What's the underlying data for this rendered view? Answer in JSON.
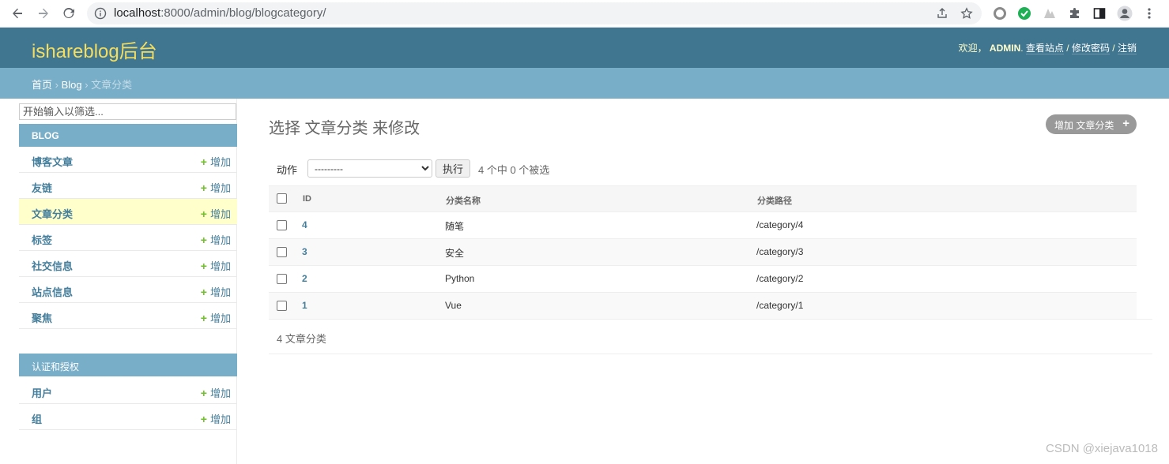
{
  "browser": {
    "url_host": "localhost",
    "url_path": ":8000/admin/blog/blogcategory/"
  },
  "header": {
    "branding": "ishareblog后台",
    "welcome": "欢迎，",
    "username": "ADMIN",
    "view_site": "查看站点",
    "change_password": "修改密码",
    "logout": "注销",
    "sep": " / "
  },
  "breadcrumbs": {
    "home": "首页",
    "app": "Blog",
    "current": "文章分类",
    "sep": " › "
  },
  "sidebar": {
    "filter_placeholder": "开始输入以筛选...",
    "modules": [
      {
        "caption": "BLOG",
        "models": [
          {
            "name": "博客文章",
            "add": "增加",
            "current": false
          },
          {
            "name": "友链",
            "add": "增加",
            "current": false
          },
          {
            "name": "文章分类",
            "add": "增加",
            "current": true
          },
          {
            "name": "标签",
            "add": "增加",
            "current": false
          },
          {
            "name": "社交信息",
            "add": "增加",
            "current": false
          },
          {
            "name": "站点信息",
            "add": "增加",
            "current": false
          },
          {
            "name": "聚焦",
            "add": "增加",
            "current": false
          }
        ]
      },
      {
        "caption": "认证和授权",
        "models": [
          {
            "name": "用户",
            "add": "增加",
            "current": false
          },
          {
            "name": "组",
            "add": "增加",
            "current": false
          }
        ]
      }
    ]
  },
  "main": {
    "title": "选择 文章分类 来修改",
    "add_button": "增加 文章分类",
    "actions": {
      "label": "动作",
      "selected_option": "---------",
      "go_button": "执行",
      "counter": "4 个中 0 个被选"
    },
    "table": {
      "headers": [
        "ID",
        "分类名称",
        "分类路径"
      ],
      "rows": [
        [
          "4",
          "随笔",
          "/category/4"
        ],
        [
          "3",
          "安全",
          "/category/3"
        ],
        [
          "2",
          "Python",
          "/category/2"
        ],
        [
          "1",
          "Vue",
          "/category/1"
        ]
      ]
    },
    "paginator": "4 文章分类"
  },
  "watermark": "CSDN @xiejava1018",
  "colors": {
    "header_bg": "#417690",
    "breadcrumbs_bg": "#79aec8",
    "branding": "#f5dd5d",
    "link": "#447e9b",
    "add_plus": "#70bf2b",
    "current_row": "#ffffcc"
  }
}
